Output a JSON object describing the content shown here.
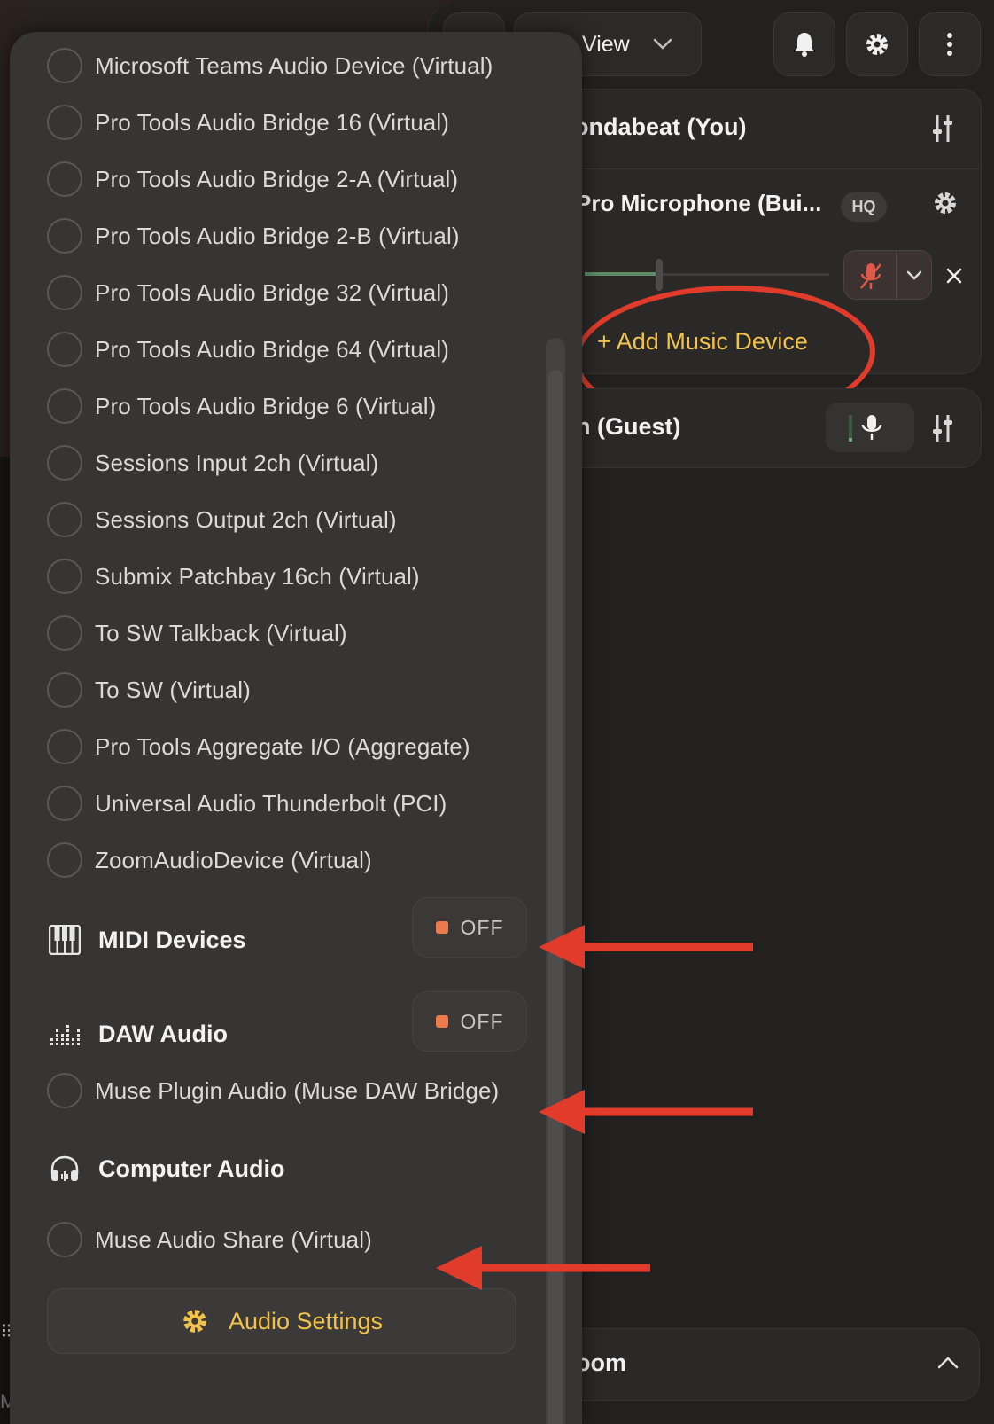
{
  "header": {
    "view_label": "View"
  },
  "participants": {
    "host_name": "ondabeat (You)",
    "host_device": "Pro Microphone (Bui...",
    "quality_badge": "HQ",
    "add_device_label": "+ Add Music Device",
    "guest_name": "n (Guest)",
    "room_label": "oom"
  },
  "dropdown": {
    "devices": [
      "Microsoft Teams Audio Device (Virtual)",
      "Pro Tools Audio Bridge 16 (Virtual)",
      "Pro Tools Audio Bridge 2-A (Virtual)",
      "Pro Tools Audio Bridge 2-B (Virtual)",
      "Pro Tools Audio Bridge 32 (Virtual)",
      "Pro Tools Audio Bridge 64 (Virtual)",
      "Pro Tools Audio Bridge 6 (Virtual)",
      "Sessions Input 2ch (Virtual)",
      "Sessions Output 2ch (Virtual)",
      "Submix Patchbay 16ch (Virtual)",
      "To SW Talkback (Virtual)",
      "To SW (Virtual)",
      "Pro Tools Aggregate I/O (Aggregate)",
      "Universal Audio Thunderbolt (PCI)",
      "ZoomAudioDevice (Virtual)"
    ],
    "midi": {
      "title": "MIDI Devices",
      "toggle": "OFF"
    },
    "daw": {
      "title": "DAW Audio",
      "toggle": "OFF",
      "devices": [
        "Muse Plugin Audio (Muse DAW Bridge)"
      ]
    },
    "computer": {
      "title": "Computer Audio",
      "devices": [
        "Muse Audio Share (Virtual)"
      ]
    },
    "settings_button": "Audio Settings"
  },
  "colors": {
    "accent_yellow": "#f1c34b",
    "toggle_off_dot": "#ec7a4c",
    "annotation_red": "#e13b2b"
  },
  "icons": [
    "bell-icon",
    "gear-icon",
    "more-vertical-icon",
    "chevron-down-icon",
    "mixer-icon",
    "mic-muted-icon",
    "mic-icon",
    "close-icon",
    "piano-icon",
    "equalizer-icon",
    "headphones-icon",
    "chevron-up-icon"
  ]
}
